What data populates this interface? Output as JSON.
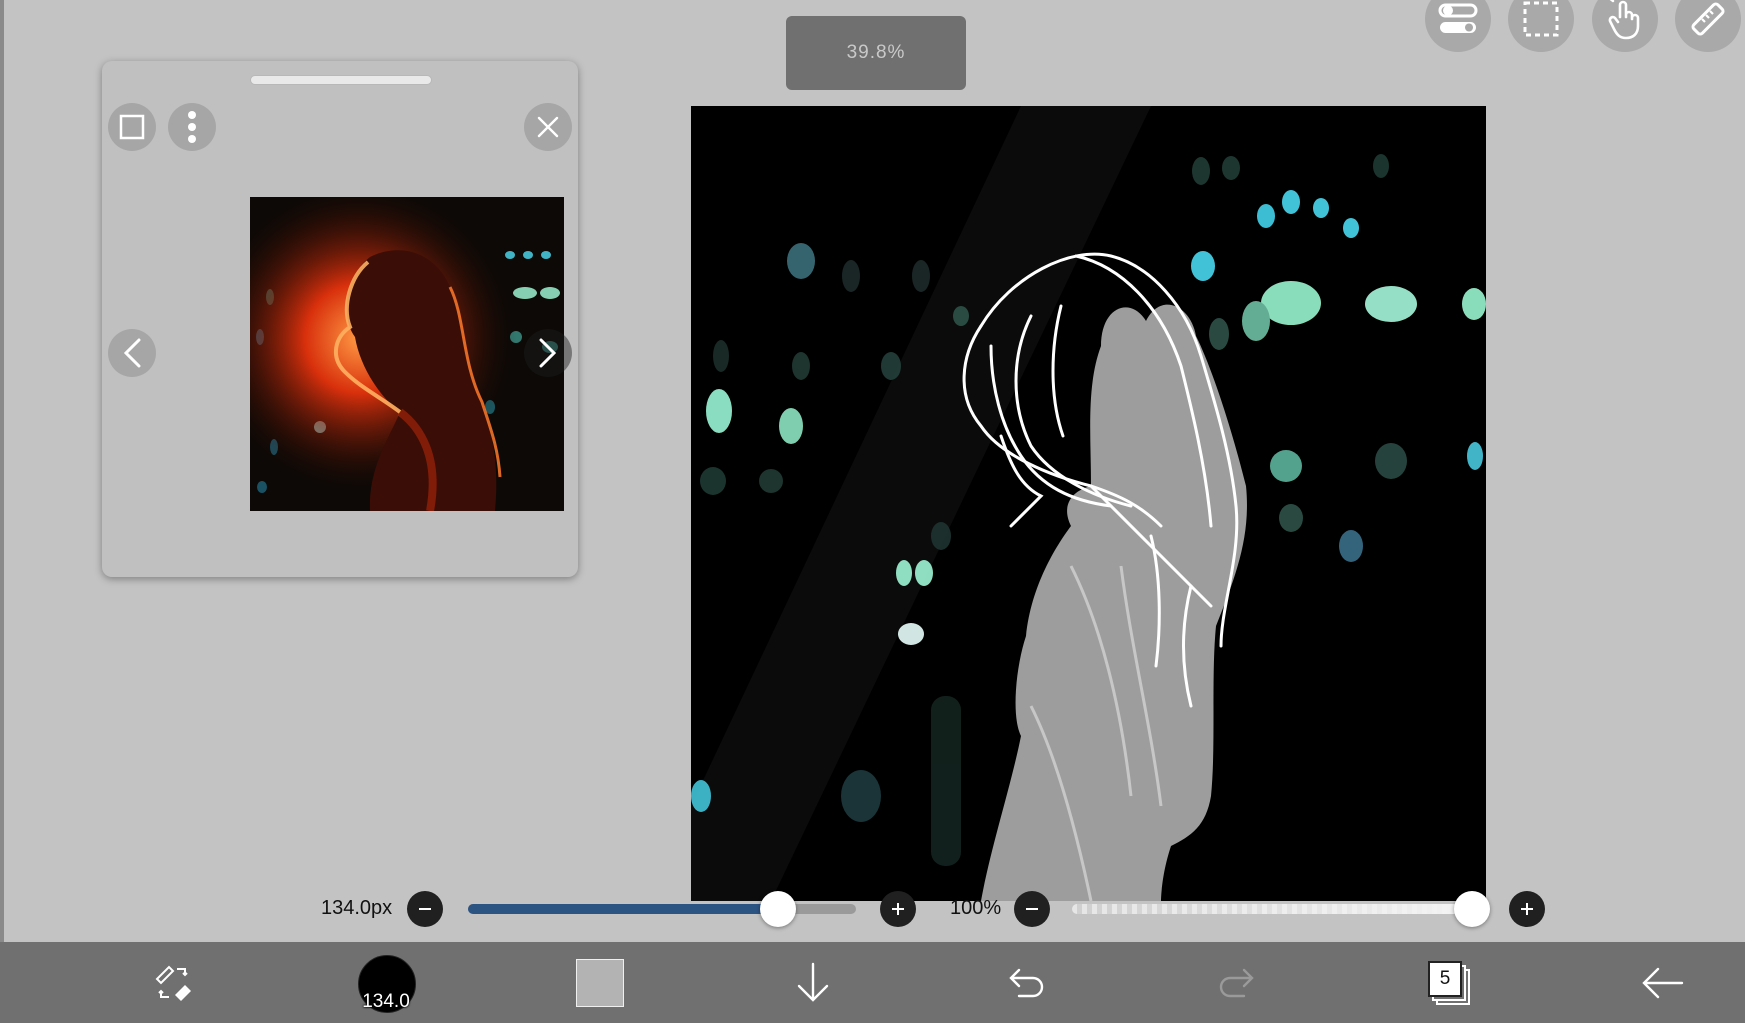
{
  "zoom": {
    "value": "39.8%"
  },
  "top_tools": [
    {
      "name": "toggle-settings-icon"
    },
    {
      "name": "selection-icon"
    },
    {
      "name": "hand-gesture-icon"
    },
    {
      "name": "ruler-icon"
    }
  ],
  "reference_window": {
    "buttons": [
      "square-icon",
      "more-vertical-icon",
      "close-icon"
    ],
    "prev_label": "<",
    "next_label": ">"
  },
  "brush_size": {
    "label": "134.0px",
    "fill": 0.8
  },
  "opacity": {
    "label": "100%",
    "fill": 1.0
  },
  "toolbar": {
    "brush_preview_label": "134.0",
    "color_swatch": "#b3b3b3",
    "layer_count": "5"
  },
  "colors": {
    "background": "#c3c3c3",
    "toolbar": "#707070",
    "slider_fill": "#2c5483"
  }
}
